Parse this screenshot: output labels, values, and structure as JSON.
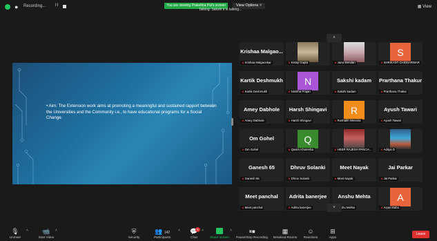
{
  "top_bar": {
    "recording_label": "Recording...",
    "pause_glyph": "II",
    "sharing_banner": "You are viewing Prakshka Pai's screen",
    "view_options": "View Options ˅",
    "talking": "Talking: Sakshi k is talking...",
    "view_label": "View"
  },
  "slide": {
    "text": "• Aim:   The Extension work aims at promoting a meaningful and sustained rapport between the Universities and the Community i.e., to have educational programs for a Social Change."
  },
  "gallery": {
    "scroll_up": "˄",
    "scroll_down": "˅",
    "tiles": [
      {
        "display": "Krishaa Malgao...",
        "caption": "Krishaa Malgaonkar"
      },
      {
        "display": "",
        "caption": "Kislay Gupta"
      },
      {
        "display": "",
        "caption": "Janvi Bendan"
      },
      {
        "display": "S",
        "caption": "SHRIKANT CHIDDARWAR",
        "avatar_color": "#e8643c"
      },
      {
        "display": "Kartik Deshmukh",
        "caption": "Kartik Deshmukh"
      },
      {
        "display": "N",
        "caption": "Nishtha Prajan",
        "avatar_color": "#a855d6"
      },
      {
        "display": "Sakshi kadam",
        "caption": "Sakshi kadam"
      },
      {
        "display": "Prarthana Thakur",
        "caption": "Prarthana Thakur"
      },
      {
        "display": "Amey Dabhole",
        "caption": "Amey Dabhole"
      },
      {
        "display": "Harsh Shingavi",
        "caption": "Harsh Shingavi"
      },
      {
        "display": "R",
        "caption": "Rushabh Menaria",
        "avatar_color": "#f28c1a"
      },
      {
        "display": "Ayush Tawari",
        "caption": "Ayush Tawari"
      },
      {
        "display": "Om Gohel",
        "caption": "Om Gohel"
      },
      {
        "display": "Q",
        "caption": "Qasim Khareeba",
        "avatar_color": "#3a8a2e"
      },
      {
        "display": "",
        "caption": "HEER RAJESH PANCH..."
      },
      {
        "display": "",
        "caption": "Aditya D"
      },
      {
        "display": "Ganesh 65",
        "caption": "Ganesh 65"
      },
      {
        "display": "Dhruv Solanki",
        "caption": "Dhruv Solanki"
      },
      {
        "display": "Meet Nayak",
        "caption": "Meet Nayak"
      },
      {
        "display": "Jai Parkar",
        "caption": "Jai Parkar"
      },
      {
        "display": "Meet panchal",
        "caption": "Meet panchal"
      },
      {
        "display": "Adrita banerjee",
        "caption": "Adrita banerjee"
      },
      {
        "display": "Anshu Mehta",
        "caption": "Anshu Mehta"
      },
      {
        "display": "A",
        "caption": "Aryan Babu",
        "avatar_color": "#e8643c"
      }
    ]
  },
  "toolbar": {
    "unmute": "Unmute",
    "start_video": "Start Video",
    "security": "Security",
    "participants": "Participants",
    "participants_count": "142",
    "chat": "Chat",
    "chat_badge": "5",
    "share_screen": "Share Screen",
    "pause_recording": "Pause/Stop Recording",
    "breakout_rooms": "Breakout Rooms",
    "reactions": "Reactions",
    "apps": "Apps",
    "leave": "Leave"
  },
  "colors": {
    "accent_green": "#22c55e",
    "leave_red": "#e03131",
    "mic_muted_red": "#e03131"
  }
}
